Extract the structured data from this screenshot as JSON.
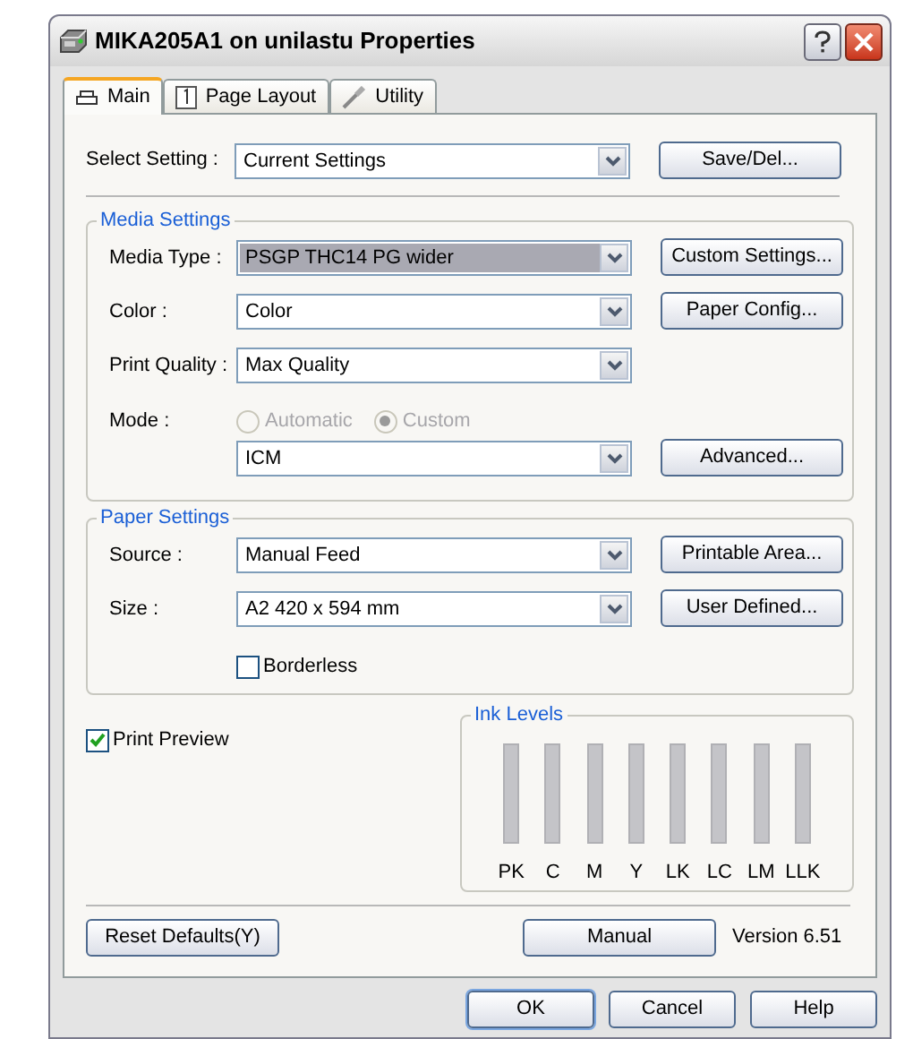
{
  "window": {
    "title": "MIKA205A1 on unilastu Properties"
  },
  "tabs": [
    {
      "label": "Main",
      "selected": true
    },
    {
      "label": "Page Layout",
      "selected": false
    },
    {
      "label": "Utility",
      "selected": false
    }
  ],
  "select_setting": {
    "label": "Select Setting :",
    "value": "Current Settings",
    "button": "Save/Del..."
  },
  "media_settings": {
    "title": "Media Settings",
    "rows": [
      {
        "kind": "combo",
        "label": "Media Type :",
        "value": "PSGP THC14 PG wider",
        "highlighted": true,
        "button": "Custom Settings..."
      },
      {
        "kind": "combo",
        "label": "Color :",
        "value": "Color",
        "highlighted": false,
        "button": "Paper Config..."
      },
      {
        "kind": "combo",
        "label": "Print Quality :",
        "value": "Max Quality",
        "highlighted": false
      },
      {
        "kind": "radio",
        "label": "Mode :",
        "disabled": true,
        "options": [
          {
            "label": "Automatic",
            "selected": false
          },
          {
            "label": "Custom",
            "selected": true
          }
        ]
      },
      {
        "kind": "combo",
        "value": "ICM",
        "highlighted": false,
        "button": "Advanced..."
      }
    ]
  },
  "paper_settings": {
    "title": "Paper Settings",
    "rows": [
      {
        "kind": "combo",
        "label": "Source :",
        "value": "Manual Feed",
        "highlighted": false,
        "button": "Printable Area..."
      },
      {
        "kind": "combo",
        "label": "Size :",
        "value": "A2 420 x 594 mm",
        "highlighted": false,
        "button": "User Defined..."
      },
      {
        "kind": "checkbox",
        "label": "Borderless",
        "checked": false
      }
    ]
  },
  "print_preview": {
    "label": "Print Preview",
    "checked": true
  },
  "ink_levels": {
    "title": "Ink Levels",
    "inks": [
      "PK",
      "C",
      "M",
      "Y",
      "LK",
      "LC",
      "LM",
      "LLK"
    ]
  },
  "footer": {
    "reset_button": "Reset Defaults(Y)",
    "manual_button": "Manual",
    "version": "Version 6.51"
  },
  "dialog_buttons": [
    "OK",
    "Cancel",
    "Help"
  ]
}
